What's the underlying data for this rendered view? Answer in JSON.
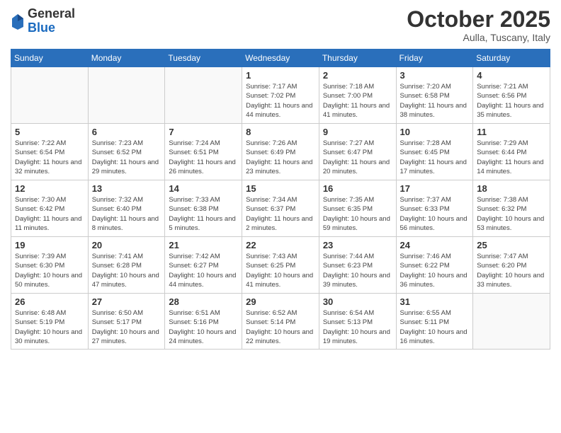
{
  "logo": {
    "general": "General",
    "blue": "Blue"
  },
  "title": "October 2025",
  "subtitle": "Aulla, Tuscany, Italy",
  "days_header": [
    "Sunday",
    "Monday",
    "Tuesday",
    "Wednesday",
    "Thursday",
    "Friday",
    "Saturday"
  ],
  "weeks": [
    [
      {
        "day": "",
        "info": ""
      },
      {
        "day": "",
        "info": ""
      },
      {
        "day": "",
        "info": ""
      },
      {
        "day": "1",
        "info": "Sunrise: 7:17 AM\nSunset: 7:02 PM\nDaylight: 11 hours and 44 minutes."
      },
      {
        "day": "2",
        "info": "Sunrise: 7:18 AM\nSunset: 7:00 PM\nDaylight: 11 hours and 41 minutes."
      },
      {
        "day": "3",
        "info": "Sunrise: 7:20 AM\nSunset: 6:58 PM\nDaylight: 11 hours and 38 minutes."
      },
      {
        "day": "4",
        "info": "Sunrise: 7:21 AM\nSunset: 6:56 PM\nDaylight: 11 hours and 35 minutes."
      }
    ],
    [
      {
        "day": "5",
        "info": "Sunrise: 7:22 AM\nSunset: 6:54 PM\nDaylight: 11 hours and 32 minutes."
      },
      {
        "day": "6",
        "info": "Sunrise: 7:23 AM\nSunset: 6:52 PM\nDaylight: 11 hours and 29 minutes."
      },
      {
        "day": "7",
        "info": "Sunrise: 7:24 AM\nSunset: 6:51 PM\nDaylight: 11 hours and 26 minutes."
      },
      {
        "day": "8",
        "info": "Sunrise: 7:26 AM\nSunset: 6:49 PM\nDaylight: 11 hours and 23 minutes."
      },
      {
        "day": "9",
        "info": "Sunrise: 7:27 AM\nSunset: 6:47 PM\nDaylight: 11 hours and 20 minutes."
      },
      {
        "day": "10",
        "info": "Sunrise: 7:28 AM\nSunset: 6:45 PM\nDaylight: 11 hours and 17 minutes."
      },
      {
        "day": "11",
        "info": "Sunrise: 7:29 AM\nSunset: 6:44 PM\nDaylight: 11 hours and 14 minutes."
      }
    ],
    [
      {
        "day": "12",
        "info": "Sunrise: 7:30 AM\nSunset: 6:42 PM\nDaylight: 11 hours and 11 minutes."
      },
      {
        "day": "13",
        "info": "Sunrise: 7:32 AM\nSunset: 6:40 PM\nDaylight: 11 hours and 8 minutes."
      },
      {
        "day": "14",
        "info": "Sunrise: 7:33 AM\nSunset: 6:38 PM\nDaylight: 11 hours and 5 minutes."
      },
      {
        "day": "15",
        "info": "Sunrise: 7:34 AM\nSunset: 6:37 PM\nDaylight: 11 hours and 2 minutes."
      },
      {
        "day": "16",
        "info": "Sunrise: 7:35 AM\nSunset: 6:35 PM\nDaylight: 10 hours and 59 minutes."
      },
      {
        "day": "17",
        "info": "Sunrise: 7:37 AM\nSunset: 6:33 PM\nDaylight: 10 hours and 56 minutes."
      },
      {
        "day": "18",
        "info": "Sunrise: 7:38 AM\nSunset: 6:32 PM\nDaylight: 10 hours and 53 minutes."
      }
    ],
    [
      {
        "day": "19",
        "info": "Sunrise: 7:39 AM\nSunset: 6:30 PM\nDaylight: 10 hours and 50 minutes."
      },
      {
        "day": "20",
        "info": "Sunrise: 7:41 AM\nSunset: 6:28 PM\nDaylight: 10 hours and 47 minutes."
      },
      {
        "day": "21",
        "info": "Sunrise: 7:42 AM\nSunset: 6:27 PM\nDaylight: 10 hours and 44 minutes."
      },
      {
        "day": "22",
        "info": "Sunrise: 7:43 AM\nSunset: 6:25 PM\nDaylight: 10 hours and 41 minutes."
      },
      {
        "day": "23",
        "info": "Sunrise: 7:44 AM\nSunset: 6:23 PM\nDaylight: 10 hours and 39 minutes."
      },
      {
        "day": "24",
        "info": "Sunrise: 7:46 AM\nSunset: 6:22 PM\nDaylight: 10 hours and 36 minutes."
      },
      {
        "day": "25",
        "info": "Sunrise: 7:47 AM\nSunset: 6:20 PM\nDaylight: 10 hours and 33 minutes."
      }
    ],
    [
      {
        "day": "26",
        "info": "Sunrise: 6:48 AM\nSunset: 5:19 PM\nDaylight: 10 hours and 30 minutes."
      },
      {
        "day": "27",
        "info": "Sunrise: 6:50 AM\nSunset: 5:17 PM\nDaylight: 10 hours and 27 minutes."
      },
      {
        "day": "28",
        "info": "Sunrise: 6:51 AM\nSunset: 5:16 PM\nDaylight: 10 hours and 24 minutes."
      },
      {
        "day": "29",
        "info": "Sunrise: 6:52 AM\nSunset: 5:14 PM\nDaylight: 10 hours and 22 minutes."
      },
      {
        "day": "30",
        "info": "Sunrise: 6:54 AM\nSunset: 5:13 PM\nDaylight: 10 hours and 19 minutes."
      },
      {
        "day": "31",
        "info": "Sunrise: 6:55 AM\nSunset: 5:11 PM\nDaylight: 10 hours and 16 minutes."
      },
      {
        "day": "",
        "info": ""
      }
    ]
  ]
}
